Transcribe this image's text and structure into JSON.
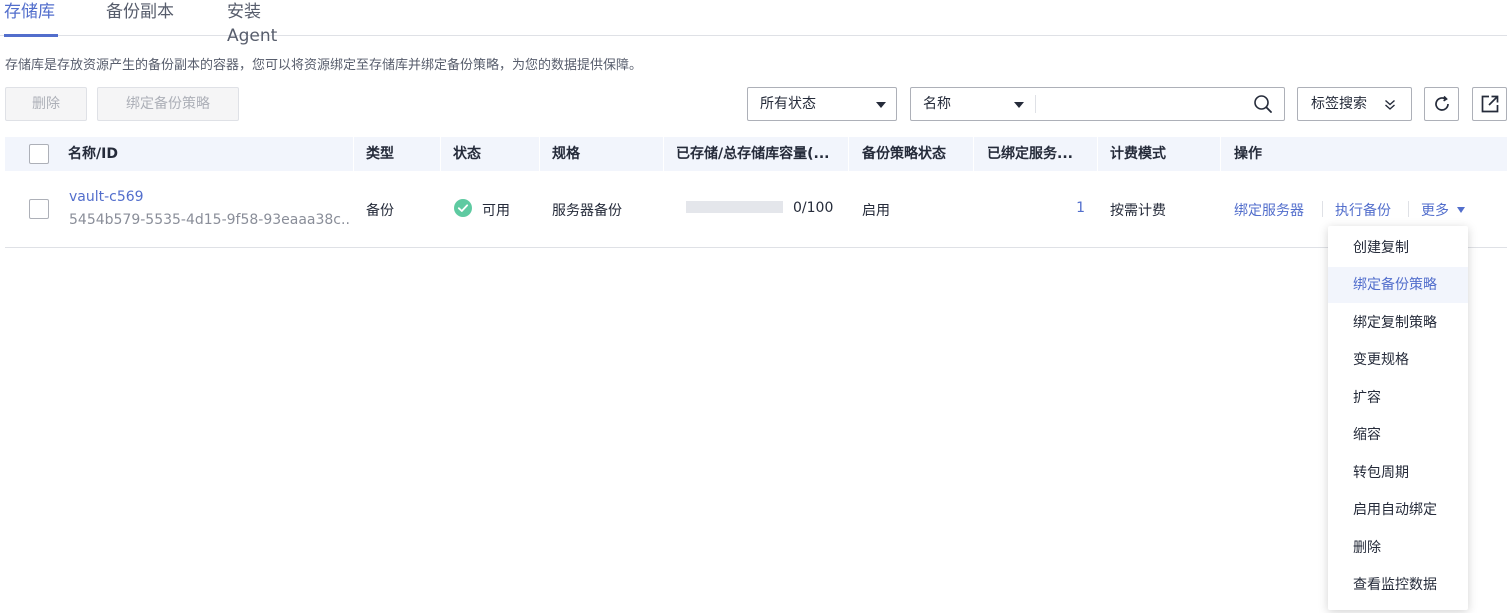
{
  "tabs": [
    {
      "label": "存储库"
    },
    {
      "label": "备份副本"
    },
    {
      "label": "安装Agent"
    }
  ],
  "description": "存储库是存放资源产生的备份副本的容器，您可以将资源绑定至存储库并绑定备份策略，为您的数据提供保障。",
  "toolbar": {
    "delete_label": "删除",
    "bind_policy_label": "绑定备份策略",
    "status_filter": "所有状态",
    "search_field": "名称",
    "search_placeholder": "",
    "tag_search_label": "标签搜索"
  },
  "table": {
    "columns": [
      "名称/ID",
      "类型",
      "状态",
      "规格",
      "已存储/总存储库容量(...",
      "备份策略状态",
      "已绑定服务...",
      "计费模式",
      "操作"
    ],
    "rows": [
      {
        "name": "vault-c569",
        "id": "5454b579-5535-4d15-9f58-93eaaa38c...",
        "type": "备份",
        "status": "可用",
        "spec": "服务器备份",
        "capacity_text": "0/100",
        "capacity_fraction": 0,
        "policy_status": "启用",
        "bound_servers": "1",
        "billing": "按需计费",
        "actions": {
          "bind_server": "绑定服务器",
          "run_backup": "执行备份",
          "more": "更多"
        }
      }
    ]
  },
  "more_menu": {
    "items": [
      "创建复制",
      "绑定备份策略",
      "绑定复制策略",
      "变更规格",
      "扩容",
      "缩容",
      "转包周期",
      "启用自动绑定",
      "删除",
      "查看监控数据"
    ],
    "hovered_index": 1
  },
  "colors": {
    "accent": "#526ecc",
    "status_ok": "#5ecaa1",
    "header_bg": "#f2f5fc"
  }
}
